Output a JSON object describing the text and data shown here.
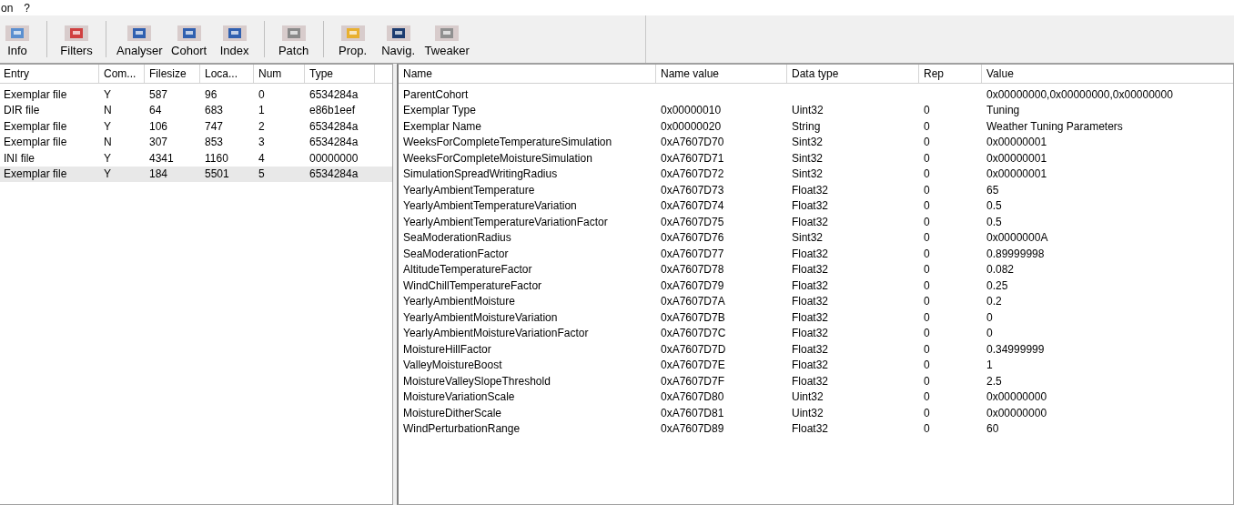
{
  "menu_bar": [
    "on",
    "?"
  ],
  "toolbar": {
    "groups": [
      [
        {
          "label": "Info"
        }
      ],
      [
        {
          "label": "Filters"
        }
      ],
      [
        {
          "label": "Analyser"
        },
        {
          "label": "Cohort"
        },
        {
          "label": "Index"
        }
      ],
      [
        {
          "label": "Patch"
        }
      ],
      [
        {
          "label": "Prop."
        },
        {
          "label": "Navig."
        },
        {
          "label": "Tweaker"
        }
      ]
    ]
  },
  "entries": {
    "columns": [
      "Entry",
      "Com...",
      "Filesize",
      "Loca...",
      "Num",
      "Type"
    ],
    "rows": [
      {
        "cells": [
          "Exemplar file",
          "Y",
          "587",
          "96",
          "0",
          "6534284a"
        ],
        "selected": false
      },
      {
        "cells": [
          "DIR file",
          "N",
          "64",
          "683",
          "1",
          "e86b1eef"
        ],
        "selected": false
      },
      {
        "cells": [
          "Exemplar file",
          "Y",
          "106",
          "747",
          "2",
          "6534284a"
        ],
        "selected": false
      },
      {
        "cells": [
          "Exemplar file",
          "N",
          "307",
          "853",
          "3",
          "6534284a"
        ],
        "selected": false
      },
      {
        "cells": [
          "INI file",
          "Y",
          "4341",
          "1160",
          "4",
          "00000000"
        ],
        "selected": false
      },
      {
        "cells": [
          "Exemplar file",
          "Y",
          "184",
          "5501",
          "5",
          "6534284a"
        ],
        "selected": true
      }
    ]
  },
  "properties": {
    "columns": [
      "Name",
      "Name value",
      "Data type",
      "Rep",
      "Value"
    ],
    "rows": [
      [
        "ParentCohort",
        null,
        null,
        null,
        "0x00000000,0x00000000,0x00000000"
      ],
      [
        "Exemplar Type",
        "0x00000010",
        "Uint32",
        "0",
        "Tuning"
      ],
      [
        "Exemplar Name",
        "0x00000020",
        "String",
        "0",
        "Weather Tuning Parameters"
      ],
      [
        "WeeksForCompleteTemperatureSimulation",
        "0xA7607D70",
        "Sint32",
        "0",
        "0x00000001"
      ],
      [
        "WeeksForCompleteMoistureSimulation",
        "0xA7607D71",
        "Sint32",
        "0",
        "0x00000001"
      ],
      [
        "SimulationSpreadWritingRadius",
        "0xA7607D72",
        "Sint32",
        "0",
        "0x00000001"
      ],
      [
        "YearlyAmbientTemperature",
        "0xA7607D73",
        "Float32",
        "0",
        "65"
      ],
      [
        "YearlyAmbientTemperatureVariation",
        "0xA7607D74",
        "Float32",
        "0",
        "0.5"
      ],
      [
        "YearlyAmbientTemperatureVariationFactor",
        "0xA7607D75",
        "Float32",
        "0",
        "0.5"
      ],
      [
        "SeaModerationRadius",
        "0xA7607D76",
        "Sint32",
        "0",
        "0x0000000A"
      ],
      [
        "SeaModerationFactor",
        "0xA7607D77",
        "Float32",
        "0",
        "0.89999998"
      ],
      [
        "AltitudeTemperatureFactor",
        "0xA7607D78",
        "Float32",
        "0",
        "0.082"
      ],
      [
        "WindChillTemperatureFactor",
        "0xA7607D79",
        "Float32",
        "0",
        "0.25"
      ],
      [
        "YearlyAmbientMoisture",
        "0xA7607D7A",
        "Float32",
        "0",
        "0.2"
      ],
      [
        "YearlyAmbientMoistureVariation",
        "0xA7607D7B",
        "Float32",
        "0",
        "0"
      ],
      [
        "YearlyAmbientMoistureVariationFactor",
        "0xA7607D7C",
        "Float32",
        "0",
        "0"
      ],
      [
        "MoistureHillFactor",
        "0xA7607D7D",
        "Float32",
        "0",
        "0.34999999"
      ],
      [
        "ValleyMoistureBoost",
        "0xA7607D7E",
        "Float32",
        "0",
        "1"
      ],
      [
        "MoistureValleySlopeThreshold",
        "0xA7607D7F",
        "Float32",
        "0",
        "2.5"
      ],
      [
        "MoistureVariationScale",
        "0xA7607D80",
        "Uint32",
        "0",
        "0x00000000"
      ],
      [
        "MoistureDitherScale",
        "0xA7607D81",
        "Uint32",
        "0",
        "0x00000000"
      ],
      [
        "WindPerturbationRange",
        "0xA7607D89",
        "Float32",
        "0",
        "60"
      ]
    ]
  }
}
